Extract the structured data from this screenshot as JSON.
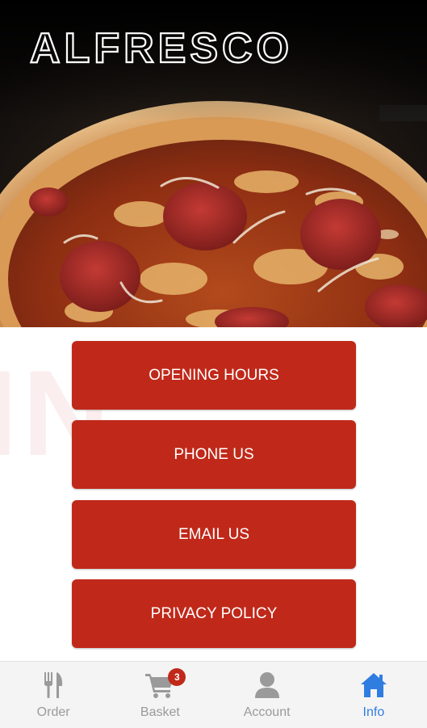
{
  "brand": {
    "name": "ALFRESCO"
  },
  "menu": {
    "opening_hours": "OPENING HOURS",
    "phone_us": "PHONE US",
    "email_us": "EMAIL US",
    "privacy_policy": "PRIVACY POLICY"
  },
  "tabs": {
    "order": {
      "label": "Order",
      "icon": "fork-knife-icon"
    },
    "basket": {
      "label": "Basket",
      "icon": "cart-icon",
      "badge": "3"
    },
    "account": {
      "label": "Account",
      "icon": "user-icon"
    },
    "info": {
      "label": "Info",
      "icon": "home-icon",
      "active": true
    }
  },
  "colors": {
    "accent": "#c0291a",
    "active_tab": "#2f7de1",
    "inactive_tab": "#9a9a9a"
  }
}
